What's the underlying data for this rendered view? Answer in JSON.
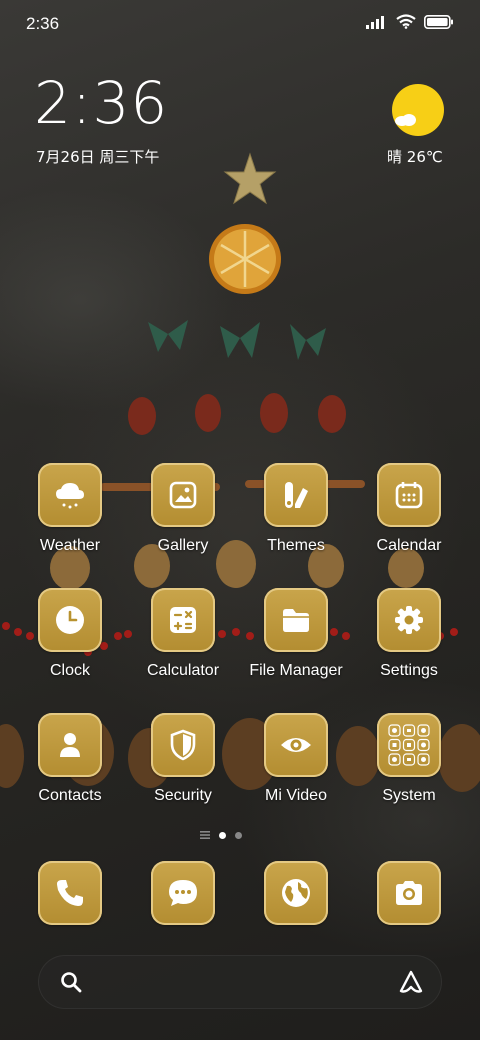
{
  "status_bar": {
    "time": "2:36"
  },
  "clock_widget": {
    "time": "2:36",
    "date": "7月26日 周三下午"
  },
  "weather_widget": {
    "condition": "晴",
    "temperature": "26℃"
  },
  "apps": [
    {
      "label": "Weather",
      "icon": "cloud-sun-icon"
    },
    {
      "label": "Gallery",
      "icon": "image-icon"
    },
    {
      "label": "Themes",
      "icon": "brush-palette-icon"
    },
    {
      "label": "Calendar",
      "icon": "calendar-icon"
    },
    {
      "label": "Clock",
      "icon": "clock-icon"
    },
    {
      "label": "Calculator",
      "icon": "calculator-icon"
    },
    {
      "label": "File Manager",
      "icon": "folder-icon"
    },
    {
      "label": "Settings",
      "icon": "gear-icon"
    },
    {
      "label": "Contacts",
      "icon": "person-icon"
    },
    {
      "label": "Security",
      "icon": "shield-icon"
    },
    {
      "label": "Mi Video",
      "icon": "eye-icon"
    },
    {
      "label": "System",
      "icon": "folder-grid-icon"
    }
  ],
  "dock": [
    {
      "icon": "phone-icon"
    },
    {
      "icon": "chat-bubble-icon"
    },
    {
      "icon": "globe-icon"
    },
    {
      "icon": "camera-icon"
    }
  ],
  "search_bar": {
    "left_icon": "search-icon",
    "right_icon": "assistant-icon"
  },
  "colors": {
    "icon_gold": "#b8922f",
    "sun_yellow": "#f7cf16"
  }
}
